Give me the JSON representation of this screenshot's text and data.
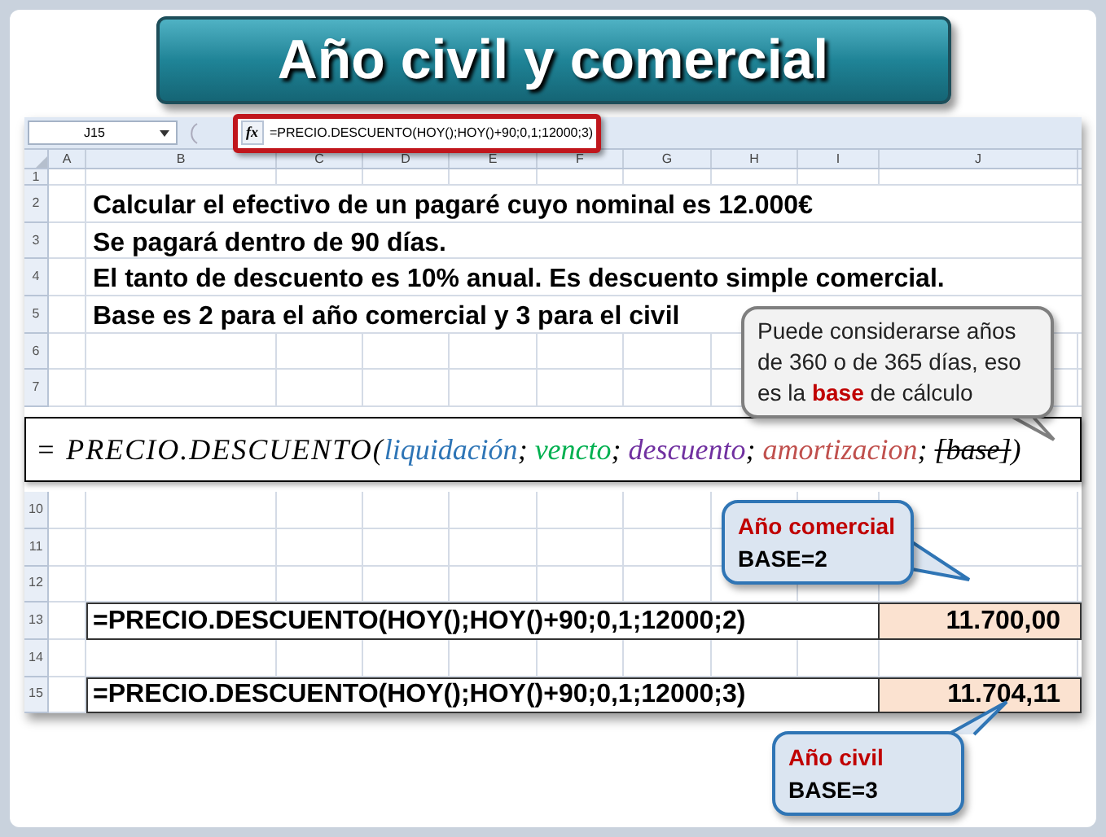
{
  "title": "Año civil y comercial",
  "formula_bar": {
    "name_box": "J15",
    "fx": "fx",
    "formula": "=PRECIO.DESCUENTO(HOY();HOY()+90;0,1;12000;3)",
    "highlighted": true
  },
  "columns": [
    "A",
    "B",
    "C",
    "D",
    "E",
    "F",
    "G",
    "H",
    "I",
    "J"
  ],
  "rows_top": [
    {
      "number": "1"
    },
    {
      "number": "2",
      "text": "Calcular el efectivo de un pagaré cuyo nominal es 12.000€"
    },
    {
      "number": "3",
      "text": "Se pagará dentro de 90 días."
    },
    {
      "number": "4",
      "text": "El tanto de descuento es 10% anual. Es descuento simple comercial."
    },
    {
      "number": "5",
      "text": "Base es 2 para el año comercial y 3 para el civil"
    },
    {
      "number": "6"
    },
    {
      "number": "7"
    }
  ],
  "syntax": {
    "prefix": "= PRECIO.DESCUENTO(",
    "separator": ";",
    "suffix": ")",
    "args": [
      {
        "text": "liquidación",
        "color": "#2e75b6",
        "struck": false
      },
      {
        "text": "vencto",
        "color": "#00b050",
        "struck": false
      },
      {
        "text": "descuento",
        "color": "#7030a0",
        "struck": false
      },
      {
        "text": "amortizacion",
        "color": "#c0504d",
        "struck": false
      },
      {
        "text": "[base]",
        "color": "#000000",
        "struck": true
      }
    ]
  },
  "rows_bottom": [
    {
      "number": "10",
      "kind": "empty"
    },
    {
      "number": "11",
      "kind": "empty"
    },
    {
      "number": "12",
      "kind": "empty"
    },
    {
      "number": "13",
      "kind": "formula",
      "formula": "=PRECIO.DESCUENTO(HOY();HOY()+90;0,1;12000;2)",
      "value": "11.700,00"
    },
    {
      "number": "14",
      "kind": "empty"
    },
    {
      "number": "15",
      "kind": "formula",
      "formula": "=PRECIO.DESCUENTO(HOY();HOY()+90;0,1;12000;3)",
      "value": "11.704,11"
    }
  ],
  "callouts": [
    {
      "kind": "note",
      "text": "Puede considerarse años de 360 o de 365 días, eso es la **base** de cálculo"
    },
    {
      "kind": "label",
      "title": "Año comercial",
      "text": "BASE=2"
    },
    {
      "kind": "label",
      "title": "Año civil",
      "text": "BASE=3"
    }
  ]
}
